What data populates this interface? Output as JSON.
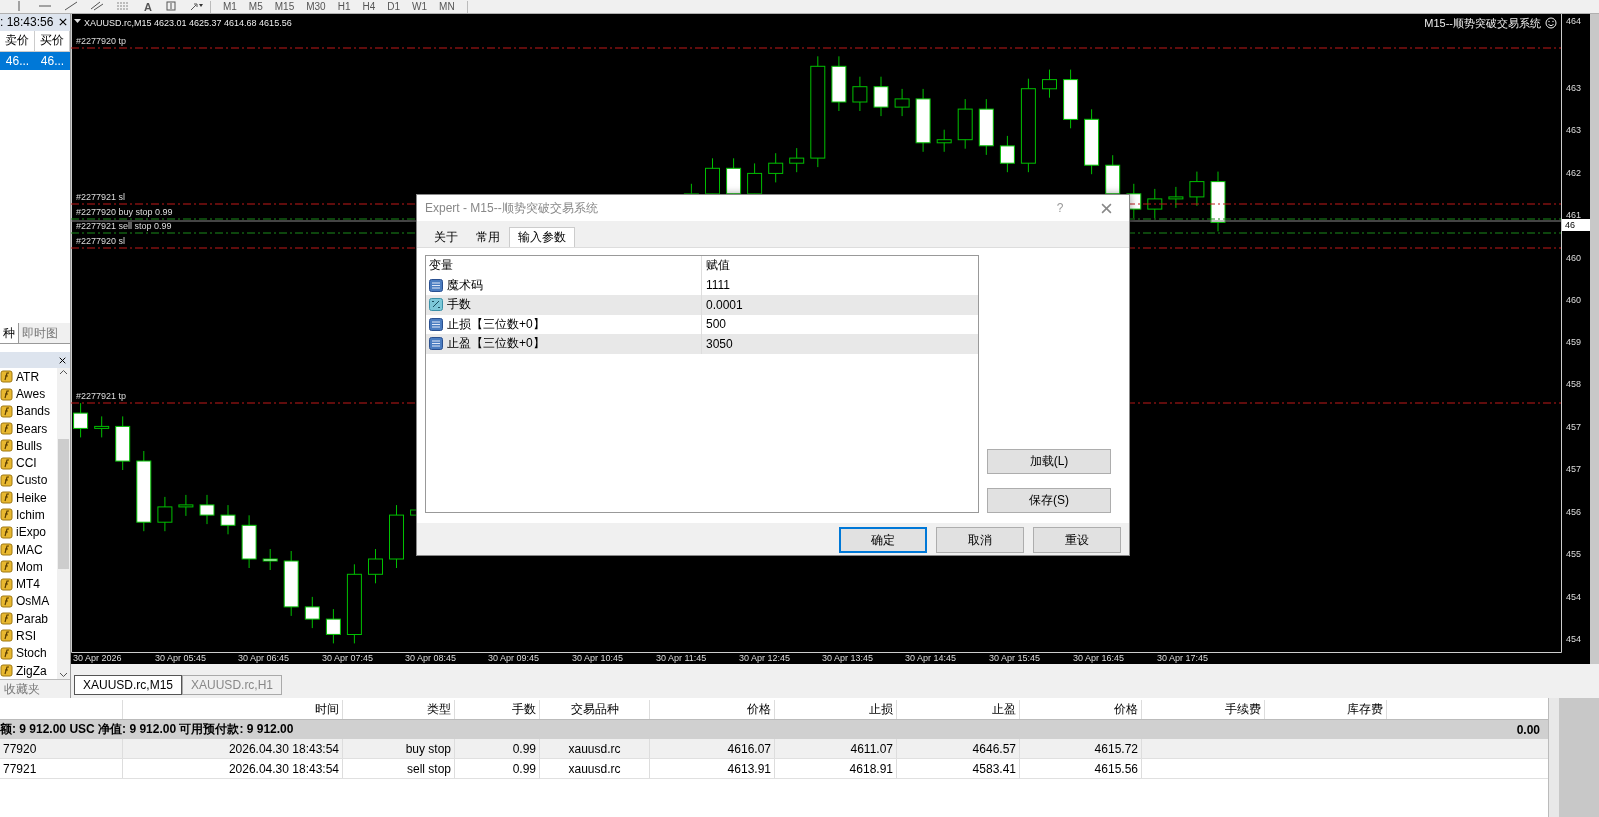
{
  "toolbar": {
    "text_tool": "A",
    "timeframes": [
      "M1",
      "M5",
      "M15",
      "M30",
      "H1",
      "H4",
      "D1",
      "W1",
      "MN"
    ]
  },
  "market_watch": {
    "time": ": 18:43:56",
    "columns": [
      "卖价",
      "买价"
    ],
    "rows": [
      {
        "bid": "46...",
        "ask": "46...",
        "selected": true
      }
    ]
  },
  "navigator": {
    "tabs": [
      {
        "label": "种",
        "selected": true
      },
      {
        "label": "即时图",
        "selected": false
      }
    ],
    "items": [
      "ATR",
      "Awes",
      "Bands",
      "Bears",
      "Bulls",
      "CCI",
      "Custo",
      "Heike",
      "Ichim",
      "iExpo",
      "MAC",
      "Mom",
      "MT4",
      "OsMA",
      "Parab",
      "RSI",
      "Stoch",
      "ZigZa"
    ],
    "bottom_tab": "收藏夹"
  },
  "chart": {
    "header": "XAUUSD.rc,M15  4623.01 4625.37 4614.68 4615.56",
    "expert": "M15--顺势突破交易系统",
    "order_lines": [
      {
        "label": "#2277920 tp",
        "kind": "stop"
      },
      {
        "label": "#2277921 sl",
        "kind": "stop"
      },
      {
        "label": "#2277920 buy stop 0.99",
        "kind": "pending"
      },
      {
        "label": "#2277921 sell stop 0.99",
        "kind": "pending"
      },
      {
        "label": "#2277920 sl",
        "kind": "stop"
      },
      {
        "label": "#2277921 tp",
        "kind": "stop"
      }
    ],
    "price_axis": [
      "464",
      "463",
      "463",
      "462",
      "461",
      "460",
      "460",
      "459",
      "458",
      "457",
      "457",
      "456",
      "455",
      "454",
      "454"
    ],
    "current_price": "46",
    "time_axis": [
      "30 Apr 2026",
      "30 Apr 05:45",
      "30 Apr 06:45",
      "30 Apr 07:45",
      "30 Apr 08:45",
      "30 Apr 09:45",
      "30 Apr 10:45",
      "30 Apr 11:45",
      "30 Apr 12:45",
      "30 Apr 13:45",
      "30 Apr 14:45",
      "30 Apr 15:45",
      "30 Apr 16:45",
      "30 Apr 17:45"
    ]
  },
  "chart_tabs": [
    {
      "label": "XAUUSD.rc,M15",
      "selected": true
    },
    {
      "label": "XAUUSD.rc,H1",
      "selected": false
    }
  ],
  "dialog": {
    "title": "Expert - M15--顺势突破交易系统",
    "help": "?",
    "tabs": [
      {
        "label": "关于",
        "selected": false
      },
      {
        "label": "常用",
        "selected": false
      },
      {
        "label": "输入参数",
        "selected": true
      }
    ],
    "columns": [
      "变量",
      "赋值"
    ],
    "params": [
      {
        "kind": "int",
        "name": "魔术码",
        "value": "1111"
      },
      {
        "kind": "double",
        "name": "手数",
        "value": "0.0001"
      },
      {
        "kind": "int",
        "name": "止损【三位数+0】",
        "value": "500"
      },
      {
        "kind": "int",
        "name": "止盈【三位数+0】",
        "value": "3050"
      }
    ],
    "side_buttons": [
      "加载(L)",
      "保存(S)"
    ],
    "buttons": [
      {
        "label": "确定",
        "default": true
      },
      {
        "label": "取消",
        "default": false
      },
      {
        "label": "重设",
        "default": false
      }
    ]
  },
  "terminal": {
    "columns": [
      "",
      "时间",
      "类型",
      "手数",
      "交易品种",
      "价格",
      "止损",
      "止盈",
      "价格",
      "手续费",
      "库存费"
    ],
    "balance": {
      "text": "额: 9 912.00 USC  净值: 9 912.00  可用预付款: 9 912.00",
      "total": "0.00"
    },
    "rows": [
      [
        "77920",
        "2026.04.30 18:43:54",
        "buy stop",
        "0.99",
        "xauusd.rc",
        "4616.07",
        "4611.07",
        "4646.57",
        "4615.72"
      ],
      [
        "77921",
        "2026.04.30 18:43:54",
        "sell stop",
        "0.99",
        "xauusd.rc",
        "4613.91",
        "4618.91",
        "4583.41",
        "4615.56"
      ]
    ]
  }
}
